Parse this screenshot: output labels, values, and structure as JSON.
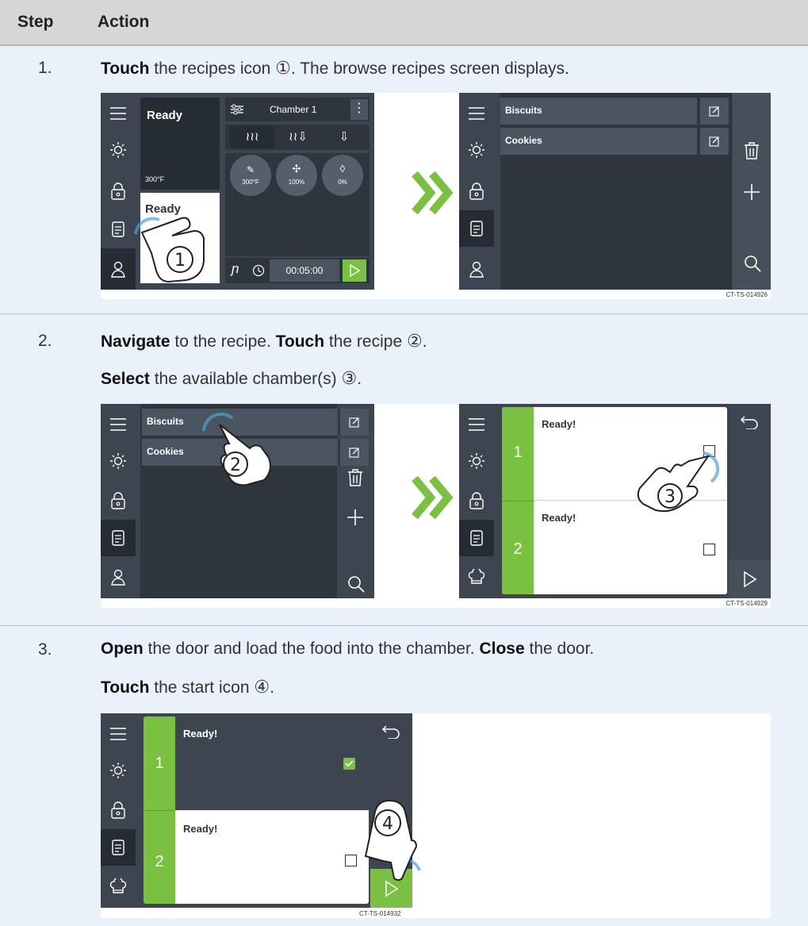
{
  "header": {
    "step": "Step",
    "action": "Action"
  },
  "steps": [
    {
      "num": "1.",
      "lines": [
        [
          {
            "t": "Touch",
            "b": true
          },
          {
            "t": " the recipes icon "
          },
          {
            "t": "①",
            "c": true
          },
          {
            "t": ". The browse recipes screen displays."
          }
        ]
      ],
      "figure_code": "CT-TS-014926"
    },
    {
      "num": "2.",
      "lines": [
        [
          {
            "t": "Navigate",
            "b": true
          },
          {
            "t": " to the recipe. "
          },
          {
            "t": "Touch",
            "b": true
          },
          {
            "t": " the recipe "
          },
          {
            "t": "②",
            "c": true
          },
          {
            "t": "."
          }
        ],
        [
          {
            "t": "Select",
            "b": true
          },
          {
            "t": " the available chamber(s) "
          },
          {
            "t": "③",
            "c": true
          },
          {
            "t": "."
          }
        ]
      ],
      "figure_code": "CT-TS-014929"
    },
    {
      "num": "3.",
      "lines": [
        [
          {
            "t": "Open",
            "b": true
          },
          {
            "t": " the door and load the food into the chamber. "
          },
          {
            "t": "Close",
            "b": true
          },
          {
            "t": " the door."
          }
        ],
        [
          {
            "t": "Touch",
            "b": true
          },
          {
            "t": " the start icon "
          },
          {
            "t": "④",
            "c": true
          },
          {
            "t": "."
          }
        ]
      ],
      "figure_code": "CT-TS-014932"
    }
  ],
  "screen_home": {
    "status_top": "Ready",
    "temp_small": "300°F",
    "status_bottom": "Ready",
    "chamber": "Chamber 1",
    "dial_temp": "300°F",
    "dial_fan": "100%",
    "dial_humidity": "0%",
    "timer": "00:05:00"
  },
  "recipes": [
    "Biscuits",
    "Cookies"
  ],
  "chambers": [
    {
      "num": "1",
      "status": "Ready!"
    },
    {
      "num": "2",
      "status": "Ready!"
    }
  ],
  "callouts": [
    "1",
    "2",
    "3",
    "4"
  ],
  "colors": {
    "accent_green": "#7ac142",
    "screen_bg": "#3c4550",
    "panel_dark": "#2e353d",
    "page_bg": "#e9f1fb"
  }
}
